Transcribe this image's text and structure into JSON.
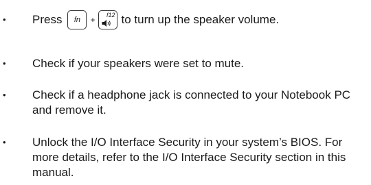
{
  "bullet": "•",
  "items": [
    {
      "before": "Press",
      "key1": "fn",
      "plus": "+",
      "key2": "f12",
      "key2_icon": "speaker-volume-up-icon",
      "after": "to turn up the speaker volume."
    },
    {
      "text": "Check if your speakers were set to mute."
    },
    {
      "text": "Check if a headphone jack is connected to your Notebook PC and remove it."
    },
    {
      "text": "Unlock the I/O Interface Security in your system’s BIOS. For more details, refer to the I/O Interface Security section in this manual."
    }
  ]
}
